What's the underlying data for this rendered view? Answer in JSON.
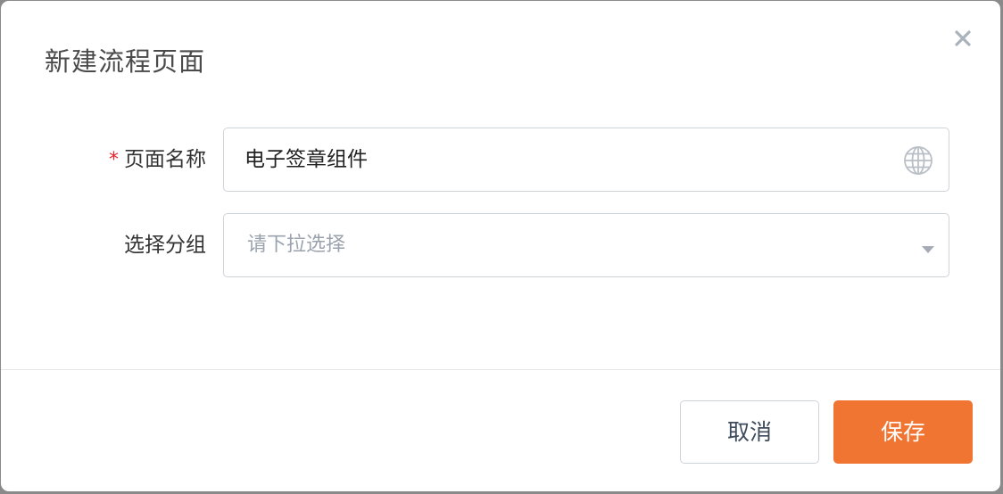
{
  "dialog": {
    "title": "新建流程页面",
    "close_icon": "close-icon"
  },
  "form": {
    "page_name": {
      "required_mark": "*",
      "label": "页面名称",
      "value": "电子签章组件",
      "icon": "globe-icon"
    },
    "group": {
      "label": "选择分组",
      "placeholder": "请下拉选择",
      "icon": "caret-down-icon"
    }
  },
  "footer": {
    "cancel_label": "取消",
    "save_label": "保存"
  },
  "colors": {
    "primary": "#f07533",
    "required": "#e8232e",
    "border": "#cfd3da",
    "placeholder": "#9aa3ad"
  }
}
